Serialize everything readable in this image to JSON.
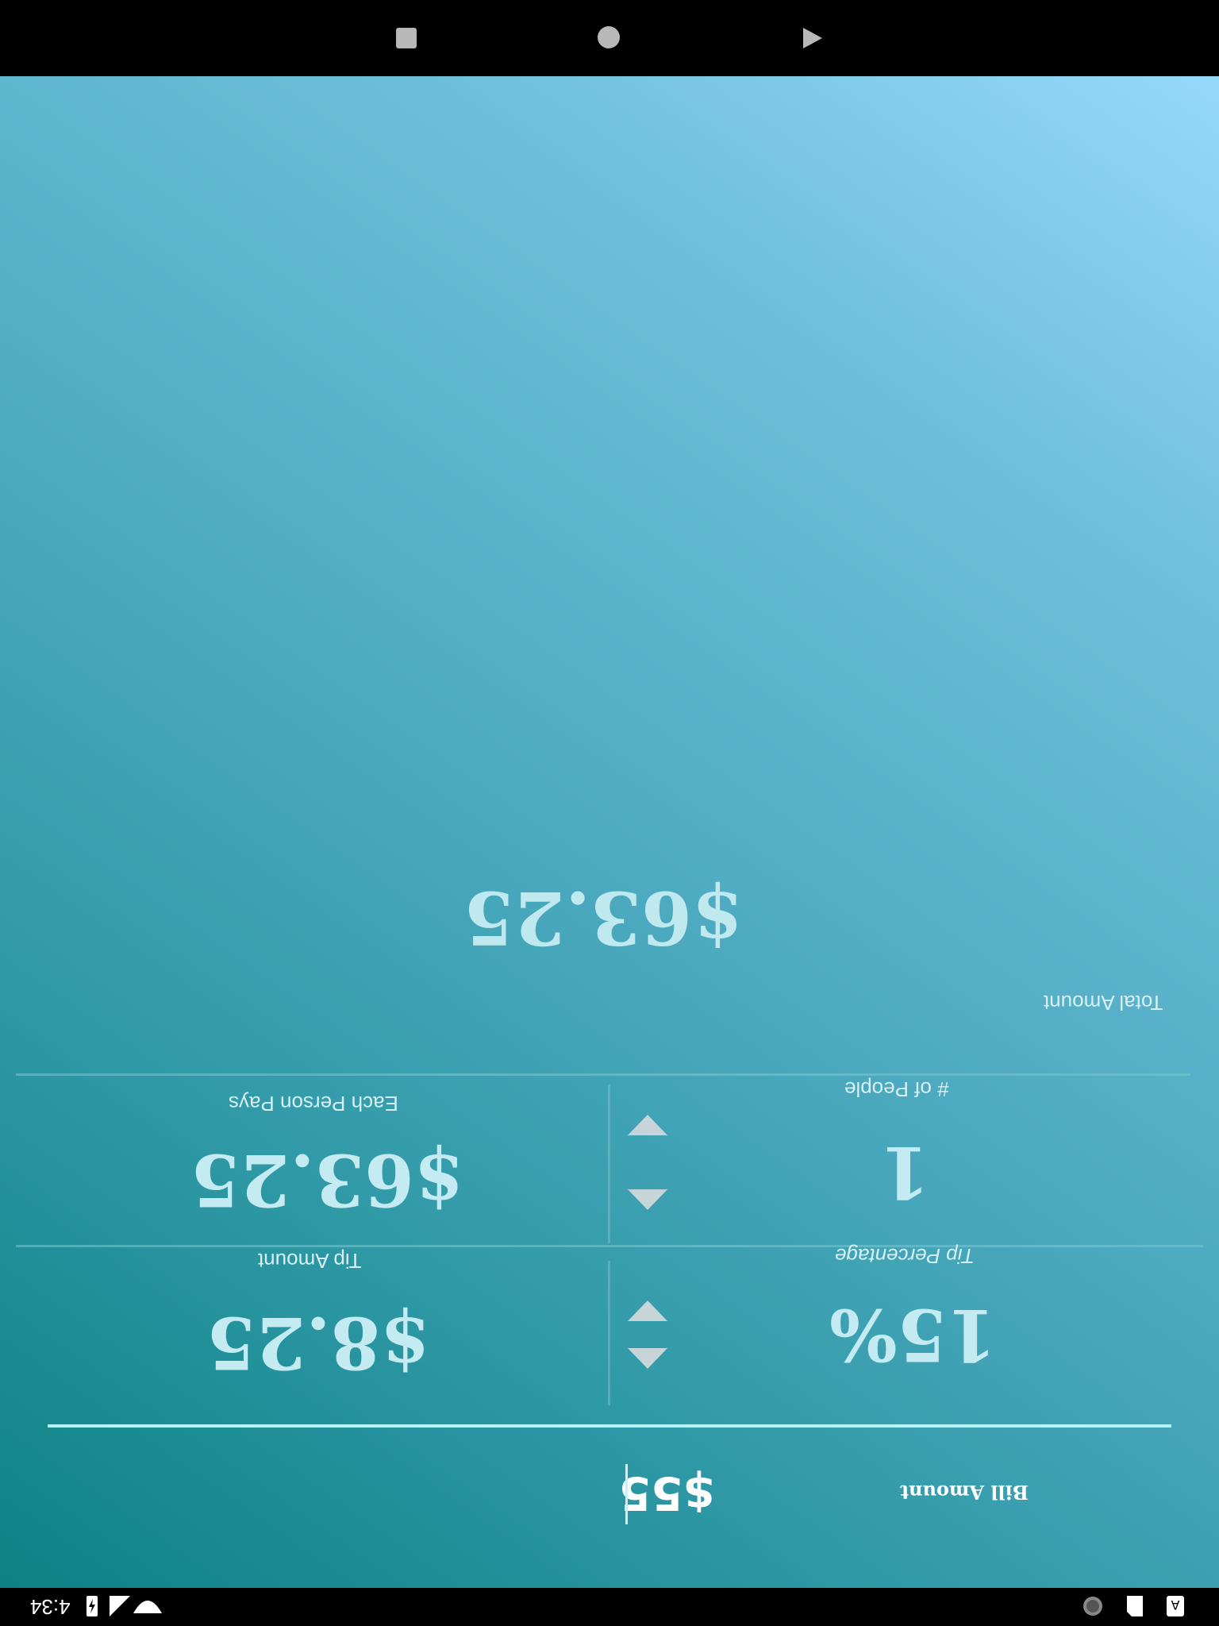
{
  "navbar": {
    "recents_icon": "square-recents-icon",
    "home_icon": "circle-home-icon",
    "back_icon": "triangle-back-icon"
  },
  "results": {
    "total_value": "$63.25",
    "total_label": "Total Amount",
    "people_label": "# of People",
    "people_value": "1",
    "each_label": "Each Person Pays",
    "each_value": "$63.25",
    "tip_pct_label": "Tip Percentage",
    "tip_pct_value": "15%",
    "tip_amount_label": "Tip Amount",
    "tip_amount_value": "$8.25"
  },
  "bill": {
    "label": "Bill Amount",
    "value": "$55"
  },
  "status": {
    "time": "4:34",
    "icons": [
      "wifi-icon",
      "signal-icon",
      "battery-charging-icon",
      "sd-card-icon",
      "sync-icon",
      "notification-a-icon"
    ]
  },
  "colors": {
    "gradient_top_right": "#96d8fb",
    "gradient_bottom_left": "#0c8285",
    "accent_line": "#b6f3f7"
  }
}
